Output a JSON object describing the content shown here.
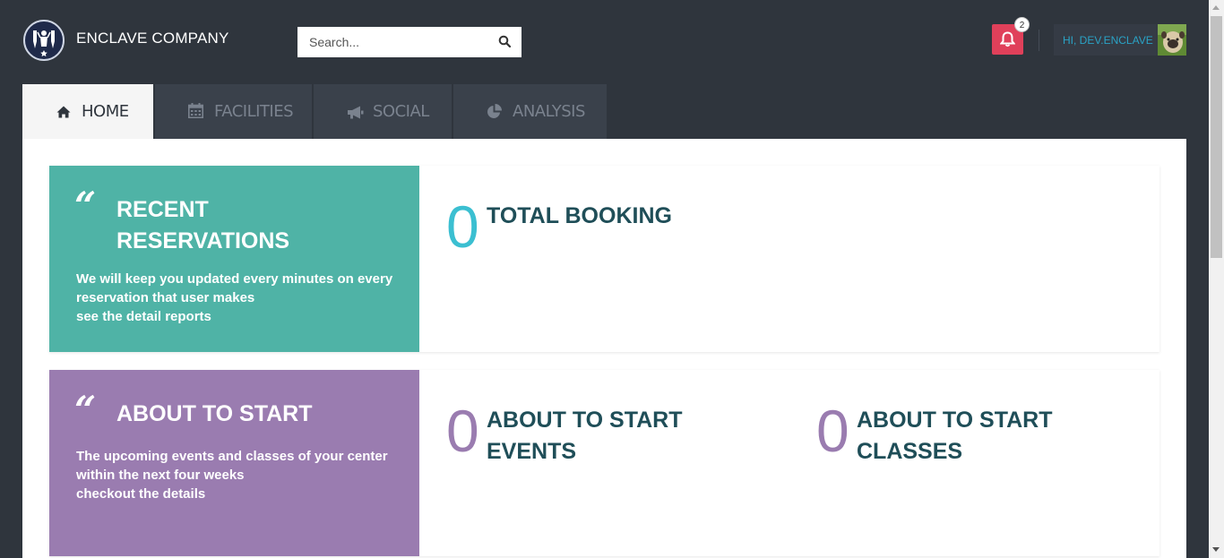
{
  "header": {
    "brand": "ENCLAVE COMPANY",
    "search_placeholder": "Search...",
    "notification_count": "2",
    "user_greeting": "HI, DEV.ENCLAVE"
  },
  "tabs": [
    {
      "label": "HOME",
      "icon": "home-icon",
      "active": true
    },
    {
      "label": "FACILITIES",
      "icon": "calendar-icon",
      "active": false
    },
    {
      "label": "SOCIAL",
      "icon": "megaphone-icon",
      "active": false
    },
    {
      "label": "ANALYSIS",
      "icon": "pie-chart-icon",
      "active": false
    }
  ],
  "sections": [
    {
      "card": {
        "quote": "“",
        "title": "RECENT RESERVATIONS",
        "desc_line1": "We will keep you updated every minutes on every reservation that user makes",
        "desc_line2": "see the detail reports",
        "color": "#4fb3a6"
      },
      "stats": [
        {
          "value": "0",
          "label": "TOTAL BOOKING",
          "color": "#3bbfd1"
        }
      ]
    },
    {
      "card": {
        "quote": "“",
        "title": "ABOUT TO START",
        "desc_line1": "The upcoming events and classes of your center within the next four weeks",
        "desc_line2": "checkout the details",
        "color": "#9a7cb0"
      },
      "stats": [
        {
          "value": "0",
          "label": "ABOUT TO START EVENTS",
          "color": "#9a7cb0"
        },
        {
          "value": "0",
          "label": "ABOUT TO START CLASSES",
          "color": "#9a7cb0"
        }
      ]
    }
  ],
  "colors": {
    "background": "#2f353d",
    "tab_inactive": "#3a414b",
    "notification": "#e0405a",
    "stat_label": "#1f4e58"
  }
}
